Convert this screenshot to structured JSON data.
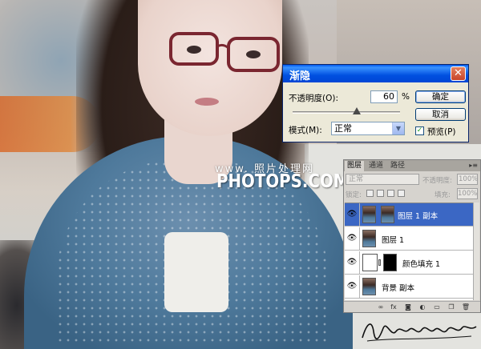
{
  "fade_dialog": {
    "title": "渐隐",
    "close_glyph": "✕",
    "opacity_label": "不透明度(O):",
    "opacity_value": "60",
    "opacity_unit": "%",
    "opacity_percent": 60,
    "mode_label": "模式(M):",
    "mode_value": "正常",
    "ok_label": "确定",
    "cancel_label": "取消",
    "preview_label": "预览(P)",
    "preview_checked": true
  },
  "watermark": {
    "line1": "www. 照片处理网",
    "line2": "PHOTOPS.COM"
  },
  "layers_panel": {
    "tabs": [
      "图层",
      "通道",
      "路径"
    ],
    "menu_glyph": "▸≡",
    "blend_mode": "正常",
    "opacity_label": "不透明度:",
    "opacity_value": "100%",
    "lock_label": "锁定:",
    "fill_label": "填充:",
    "fill_value": "100%",
    "layers": [
      {
        "name": "图层 1 副本",
        "active": true,
        "thumb": "photo",
        "has_mask": false
      },
      {
        "name": "图层 1",
        "active": false,
        "thumb": "photo",
        "has_mask": false
      },
      {
        "name": "颜色填充 1",
        "active": false,
        "thumb": "white",
        "has_mask": true
      },
      {
        "name": "背景 副本",
        "active": false,
        "thumb": "photo",
        "has_mask": false
      }
    ],
    "bottom_icons": [
      "link-icon",
      "fx-icon",
      "mask-icon",
      "adjustment-icon",
      "folder-icon",
      "new-layer-icon",
      "trash-icon"
    ]
  },
  "signature_text": "Huosheanizuo"
}
